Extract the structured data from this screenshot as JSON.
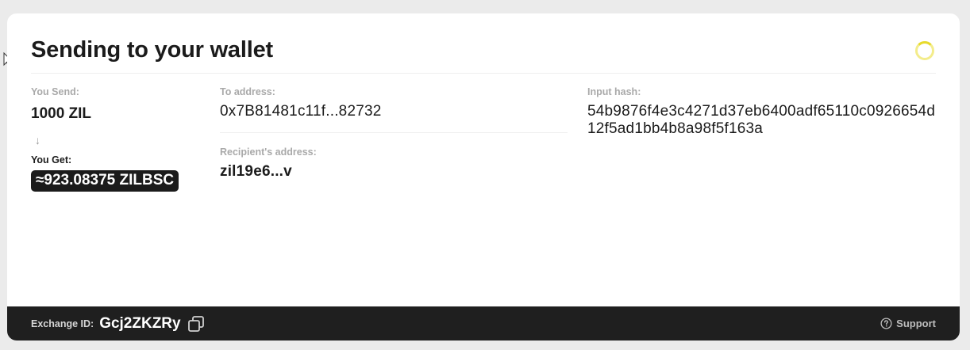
{
  "header": {
    "title": "Sending to your wallet"
  },
  "send": {
    "you_send_label": "You Send:",
    "you_send_value": "1000 ZIL",
    "arrow": "↓",
    "you_get_label": "You Get:",
    "you_get_value": "≈923.08375 ZILBSC"
  },
  "addresses": {
    "to_label": "To address:",
    "to_value": "0x7B81481c11f...82732",
    "recipient_label": "Recipient's address:",
    "recipient_value": "zil19e6...v"
  },
  "hash": {
    "label": "Input hash:",
    "value": "54b9876f4e3c4271d37eb6400adf65110c0926654d12f5ad1bb4b8a98f5f163a"
  },
  "footer": {
    "exchange_label": "Exchange ID:",
    "exchange_id": "Gcj2ZKZRy",
    "support_label": "Support"
  },
  "colors": {
    "footer_bg": "#1f1f1f",
    "spinner": "#e7da2b",
    "label_gray": "#a9a9a9"
  }
}
